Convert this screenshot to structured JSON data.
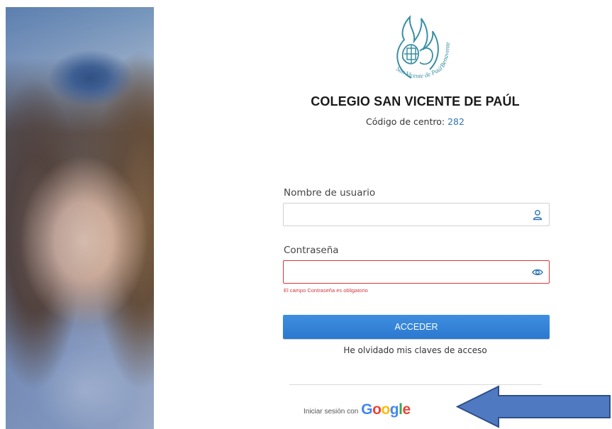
{
  "school": {
    "logo_text": "San Vicente de Paúl Benavente",
    "name": "COLEGIO SAN VICENTE DE PAÚL",
    "center_code_label": "Código de centro:",
    "center_code": "282"
  },
  "form": {
    "username_label": "Nombre de usuario",
    "username_value": "",
    "password_label": "Contraseña",
    "password_value": "",
    "password_error": "El campo Contraseña es obligatorio",
    "submit_label": "ACCEDER",
    "forgot_label": "He olvidado mis claves de acceso"
  },
  "google": {
    "label": "Iniciar sesión con",
    "brand": "Google",
    "brand_colors": [
      "#4285F4",
      "#EA4335",
      "#FBBC05",
      "#4285F4",
      "#34A853",
      "#EA4335"
    ]
  },
  "icons": {
    "username": "user-icon",
    "password": "eye-icon",
    "annotation": "arrow-left-icon"
  },
  "colors": {
    "accent": "#2b78cf",
    "link": "#2e75b6",
    "error": "#d9363e",
    "logo": "#3a8fa3",
    "arrow_fill": "#4f7ac2",
    "arrow_stroke": "#2f4f8a"
  }
}
